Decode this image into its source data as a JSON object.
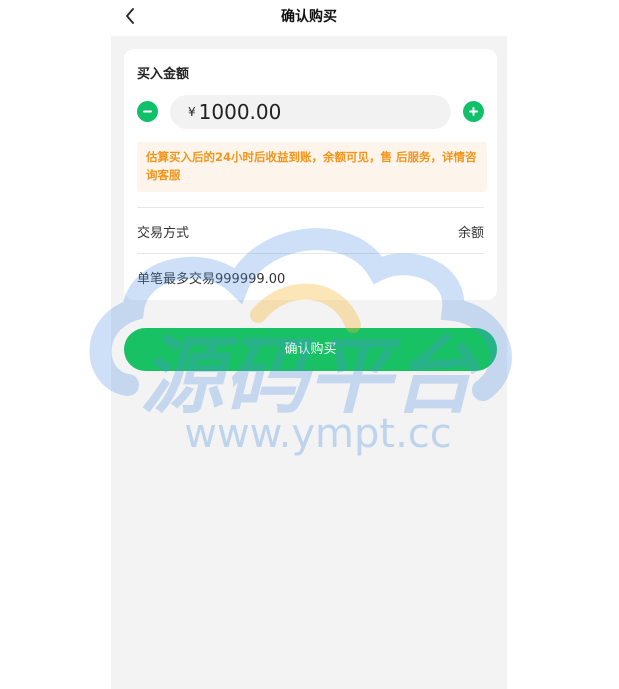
{
  "nav": {
    "title": "确认购买",
    "back_icon": "chevron-left-icon"
  },
  "purchase": {
    "label": "买入金额",
    "currency_symbol": "¥",
    "amount": "1000.00",
    "minus_icon": "minus-circle-icon",
    "plus_icon": "plus-circle-icon"
  },
  "notice": {
    "text": "估算买入后的24小时后收益到账，余额可见，售 后服务，详情咨询客服"
  },
  "payment": {
    "label": "交易方式",
    "value": "余额"
  },
  "limit": {
    "text": "单笔最多交易999999.00"
  },
  "confirm_button": {
    "label": "确认购买"
  },
  "watermark": {
    "title": "源码平台",
    "url": "www.ympt.cc"
  },
  "colors": {
    "accent_green": "#12c06a",
    "notice_text": "#f2951a",
    "notice_bg": "#fdf4ec",
    "page_bg": "#f3f3f3"
  }
}
